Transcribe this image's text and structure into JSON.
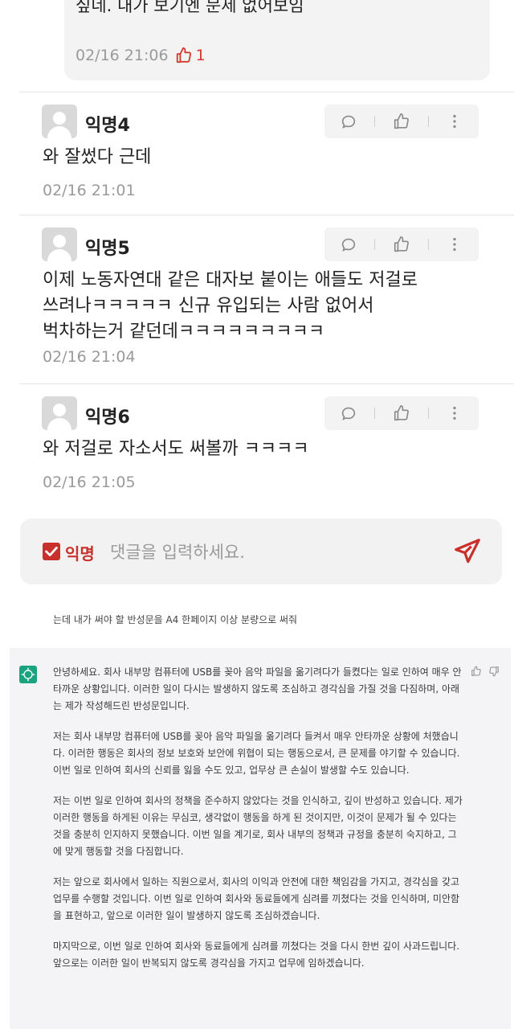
{
  "top_reply": {
    "text_line1": "",
    "text_line2": "싶네. 내가 보기엔 문제 없어보임",
    "timestamp": "02/16 21:06",
    "likes": "1"
  },
  "comments": [
    {
      "author": "익명4",
      "text": "와 잘썼다 근데",
      "timestamp": "02/16 21:01"
    },
    {
      "author": "익명5",
      "text": "이제 노동자연대 같은 대자보 붙이는 애들도 저걸로\n쓰려나ㅋㅋㅋㅋㅋ 신규 유입되는 사람 없어서\n벅차하는거 같던데ㅋㅋㅋㅋㅋㅋㅋㅋㅋ",
      "timestamp": "02/16 21:04"
    },
    {
      "author": "익명6",
      "text": "와 저걸로 자소서도 써볼까 ㅋㅋㅋㅋ",
      "timestamp": "02/16 21:05"
    }
  ],
  "input_bar": {
    "anonymous_label": "익명",
    "placeholder": "댓글을 입력하세요."
  },
  "chat": {
    "user_prompt": "는데 내가 써야 할 반성문을 A4 한페이지 이상 분량으로 써줘",
    "assistant_paragraphs": [
      "안녕하세요. 회사 내부망 컴퓨터에 USB를 꽂아 음악 파일을 옮기려다가 들켰다는 일로 인하여 매우 안타까운 상황입니다. 이러한 일이 다시는 발생하지 않도록 조심하고 경각심을 가질 것을 다짐하며, 아래는 제가 작성해드린 반성문입니다.",
      "저는 회사 내부망 컴퓨터에 USB를 꽂아 음악 파일을 옮기려다 들켜서 매우 안타까운 상황에 처했습니다. 이러한 행동은 회사의 정보 보호와 보안에 위협이 되는 행동으로서, 큰 문제를 야기할 수 있습니다. 이번 일로 인하여 회사의 신뢰를 잃을 수도 있고, 업무상 큰 손실이 발생할 수도 있습니다.",
      "저는 이번 일로 인하여 회사의 정책을 준수하지 않았다는 것을 인식하고, 깊이 반성하고 있습니다. 제가 이러한 행동을 하게된 이유는 무심코, 생각없이 행동을 하게 된 것이지만, 이것이 문제가 될 수 있다는 것을 충분히 인지하지 못했습니다. 이번 일을 계기로, 회사 내부의 정책과 규정을 충분히 숙지하고, 그에 맞게 행동할 것을 다짐합니다.",
      "저는 앞으로 회사에서 일하는 직원으로서, 회사의 이익과 안전에 대한 책임감을 가지고, 경각심을 갖고 업무를 수행할 것입니다. 이번 일로 인하여 회사와 동료들에게 심려를 끼쳤다는 것을 인식하며, 미안함을 표현하고, 앞으로 이러한 일이 발생하지 않도록 조심하겠습니다.",
      "마지막으로, 이번 일로 인하여 회사와 동료들에게 심려를 끼쳤다는 것을 다시 한번 깊이 사과드립니다. 앞으로는 이러한 일이 반복되지 않도록 경각심을 가지고 업무에 임하겠습니다."
    ]
  },
  "colors": {
    "accent_red": "#c9302c",
    "gpt_green": "#19a37f"
  }
}
